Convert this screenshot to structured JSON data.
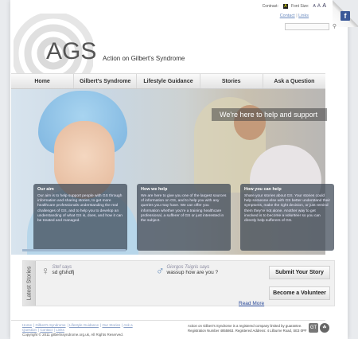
{
  "topbar": {
    "contrast_label": "Contrast:",
    "contrast_value": "A",
    "font_size_label": "Font Size:",
    "font_sizes": [
      "A",
      "A",
      "A"
    ]
  },
  "toplinks": {
    "contact": "Contact",
    "separator": "|",
    "links": "Links"
  },
  "search": {
    "placeholder": ""
  },
  "logo": {
    "acronym": "AGS",
    "full_name": "Action on Gilbert's Syndrome"
  },
  "nav": {
    "items": [
      {
        "label": "Home"
      },
      {
        "label": "Gilbert's Syndrome"
      },
      {
        "label": "Lifestyle Guidance"
      },
      {
        "label": "Stories"
      },
      {
        "label": "Ask a Question"
      }
    ]
  },
  "hero": {
    "banner": "We're here to help and support",
    "boxes": [
      {
        "title": "Our aim",
        "text": "Our aim is to help support people with GS through information and sharing stories, to get more healthcare professionals understanding the real challenges of GS, and to help you to develop an understanding of what GS is, does, and how it can be treated and managed."
      },
      {
        "title": "How we help",
        "text": "We are here to give you one of the largest sources of information on GS, and to help you with any queries you may have. We can offer you information whether you're a training healthcare professional, a sufferer of GS or just interested in the subject."
      },
      {
        "title": "How you can help",
        "text": "Share your stories about GS. Your stories could help someone else with GS better understand their symptoms, make the right decision, or just remind them they're not alone. Another way to get involved is to become a volunteer so you can directly help sufferers of GS."
      }
    ]
  },
  "stories": {
    "tab_label": "Latest Stories",
    "items": [
      {
        "name": "Stef says",
        "text": "sd gfshdfj",
        "gender": "female",
        "gender_icon": "♀",
        "color": "#7a7a7a"
      },
      {
        "name": "Giorgos Tsigris says",
        "text": "wassup how are you ?",
        "gender": "male",
        "gender_icon": "♂",
        "color": "#5a86b8"
      }
    ],
    "submit_button": "Submit Your Story",
    "volunteer_button": "Become a Volunteer",
    "read_more": "Read More"
  },
  "footer": {
    "links": [
      "Home",
      "Gilbert's Syndrome",
      "Lifestyle Guidance",
      "Our Stories",
      "Ask a Question",
      "Contact",
      "Links"
    ],
    "copyright": "Copyright © 2011 gilbertssyndrome.org.uk, All Rights Reserved.",
    "legal": "Action on Gilbert's Syndrome is a registered company limited by guarantee. Registration Number 4855863. Registered Address: 4 Lilburne Road, SE3 0PF",
    "logos": [
      "GT",
      "☘"
    ]
  }
}
